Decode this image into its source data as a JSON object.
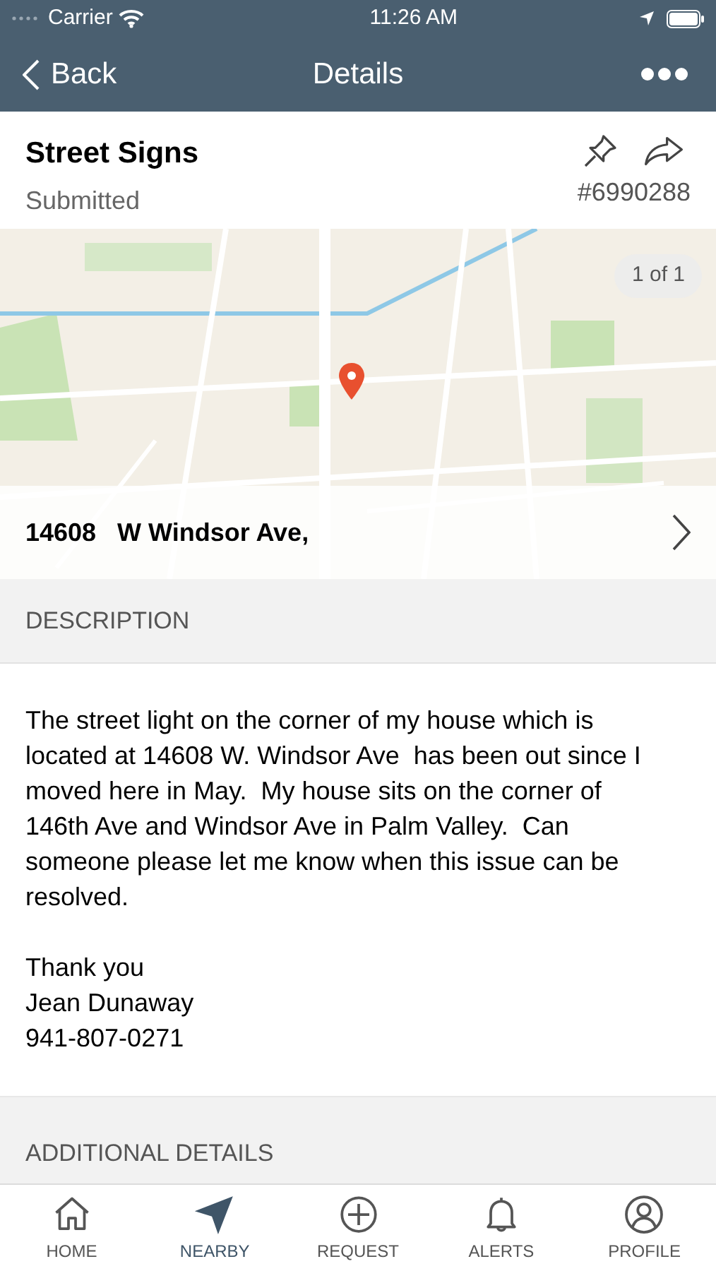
{
  "status_bar": {
    "carrier": "Carrier",
    "time": "11:26 AM"
  },
  "nav": {
    "back": "Back",
    "title": "Details"
  },
  "header": {
    "title": "Street Signs",
    "status": "Submitted",
    "number": "#6990288"
  },
  "map": {
    "counter": "1 of 1",
    "address": "14608   W Windsor Ave,"
  },
  "description": {
    "heading": "DESCRIPTION",
    "text": "The street light on the corner of my house which is located at 14608 W. Windsor Ave  has been out since I moved here in May.  My house sits on the corner of 146th Ave and Windsor Ave in Palm Valley.  Can someone please let me know when this issue can be resolved.",
    "signature": [
      "Thank you",
      "Jean Dunaway",
      "941-807-0271"
    ]
  },
  "additional": {
    "heading": "ADDITIONAL DETAILS"
  },
  "tabs": [
    {
      "kind": "home",
      "label": "HOME",
      "selected": false
    },
    {
      "kind": "nearby",
      "label": "NEARBY",
      "selected": true
    },
    {
      "kind": "request",
      "label": "REQUEST",
      "selected": false
    },
    {
      "kind": "alerts",
      "label": "ALERTS",
      "selected": false
    },
    {
      "kind": "profile",
      "label": "PROFILE",
      "selected": false
    }
  ]
}
